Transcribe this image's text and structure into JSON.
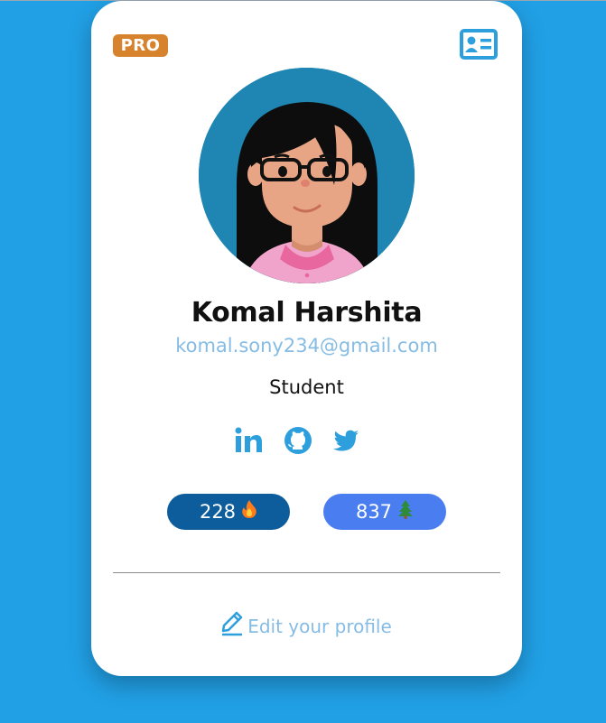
{
  "profile": {
    "badge": "PRO",
    "name": "Komal Harshita",
    "email": "komal.sony234@gmail.com",
    "role": "Student"
  },
  "social": [
    {
      "icon": "linkedin-icon"
    },
    {
      "icon": "github-icon"
    },
    {
      "icon": "twitter-icon"
    }
  ],
  "stats": {
    "flame_count": "228",
    "flame_icon": "flame-icon",
    "tree_count": "837",
    "tree_icon": "tree-icon"
  },
  "actions": {
    "edit_label": "Edit your profile",
    "edit_icon": "pencil-icon",
    "header_icon": "id-card-icon"
  },
  "colors": {
    "background": "#21a0e6",
    "badge": "#d7822c",
    "accent": "#2e9fdd",
    "flame_pill": "#0d5d9c",
    "tree_pill": "#4a7ef0",
    "muted_link": "#86bce4"
  }
}
